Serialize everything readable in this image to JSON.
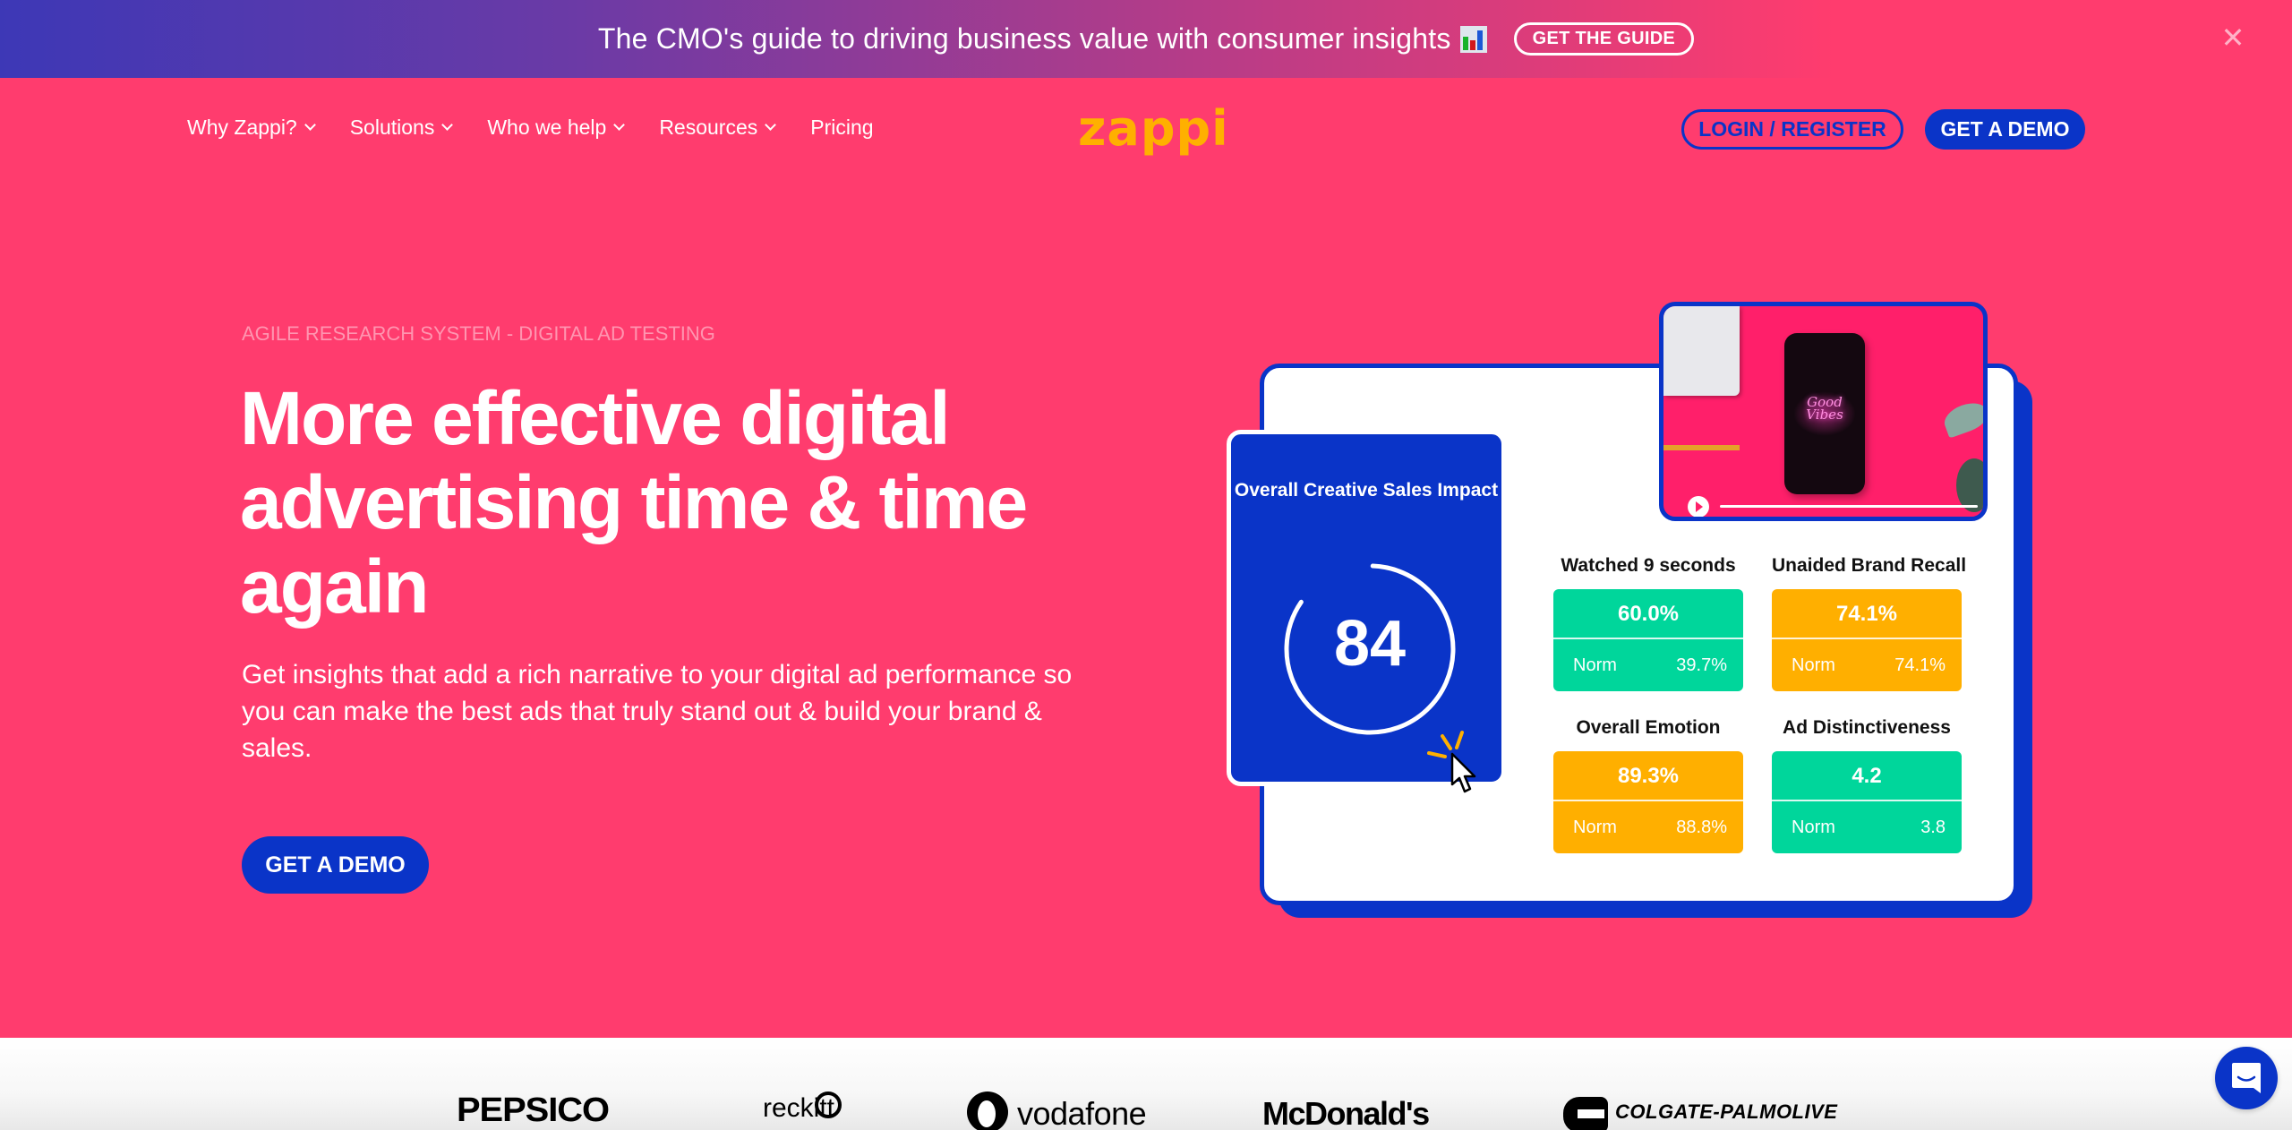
{
  "banner": {
    "text": "The CMO's guide to driving business value with consumer insights",
    "emoji_icon": "bar-chart-icon",
    "cta_label": "GET THE GUIDE",
    "close_icon": "close-icon",
    "close_glyph": "✕"
  },
  "nav": {
    "items": [
      {
        "label": "Why Zappi?",
        "has_dropdown": true
      },
      {
        "label": "Solutions",
        "has_dropdown": true
      },
      {
        "label": "Who we help",
        "has_dropdown": true
      },
      {
        "label": "Resources",
        "has_dropdown": true
      },
      {
        "label": "Pricing",
        "has_dropdown": false
      }
    ],
    "logo": "zappi",
    "login_label": "LOGIN / REGISTER",
    "demo_label": "GET A DEMO"
  },
  "hero": {
    "eyebrow": "AGILE RESEARCH SYSTEM - DIGITAL AD TESTING",
    "headline": "More effective digital advertising time & time again",
    "subtext": "Get insights that add a rich narrative to your digital ad performance so you can make the best ads that truly stand out & build your brand & sales.",
    "cta_label": "GET A DEMO"
  },
  "dashboard": {
    "video": {
      "neon_text": "Good Vibes",
      "play_icon": "play-icon"
    },
    "impact": {
      "title": "Overall Creative Sales Impact",
      "value": "84",
      "gauge_fraction": 0.84
    },
    "metrics": [
      {
        "title": "Watched 9 seconds",
        "value": "60.0%",
        "norm_label": "Norm",
        "norm_value": "39.7%",
        "status": "green"
      },
      {
        "title": "Unaided Brand Recall",
        "value": "74.1%",
        "norm_label": "Norm",
        "norm_value": "74.1%",
        "status": "orange"
      },
      {
        "title": "Overall Emotion",
        "value": "89.3%",
        "norm_label": "Norm",
        "norm_value": "88.8%",
        "status": "orange"
      },
      {
        "title": "Ad Distinctiveness",
        "value": "4.2",
        "norm_label": "Norm",
        "norm_value": "3.8",
        "status": "green"
      }
    ]
  },
  "logos": [
    "PEPSICO",
    "reckitt",
    "vodafone",
    "McDonald's",
    "COLGATE-PALMOLIVE"
  ],
  "chat": {
    "icon": "chat-icon"
  },
  "colors": {
    "brand_pink": "#ff3c6e",
    "brand_blue": "#0a34c8",
    "logo_yellow": "#ffb000",
    "status_green": "#00d69b",
    "status_orange": "#ffaf00"
  }
}
